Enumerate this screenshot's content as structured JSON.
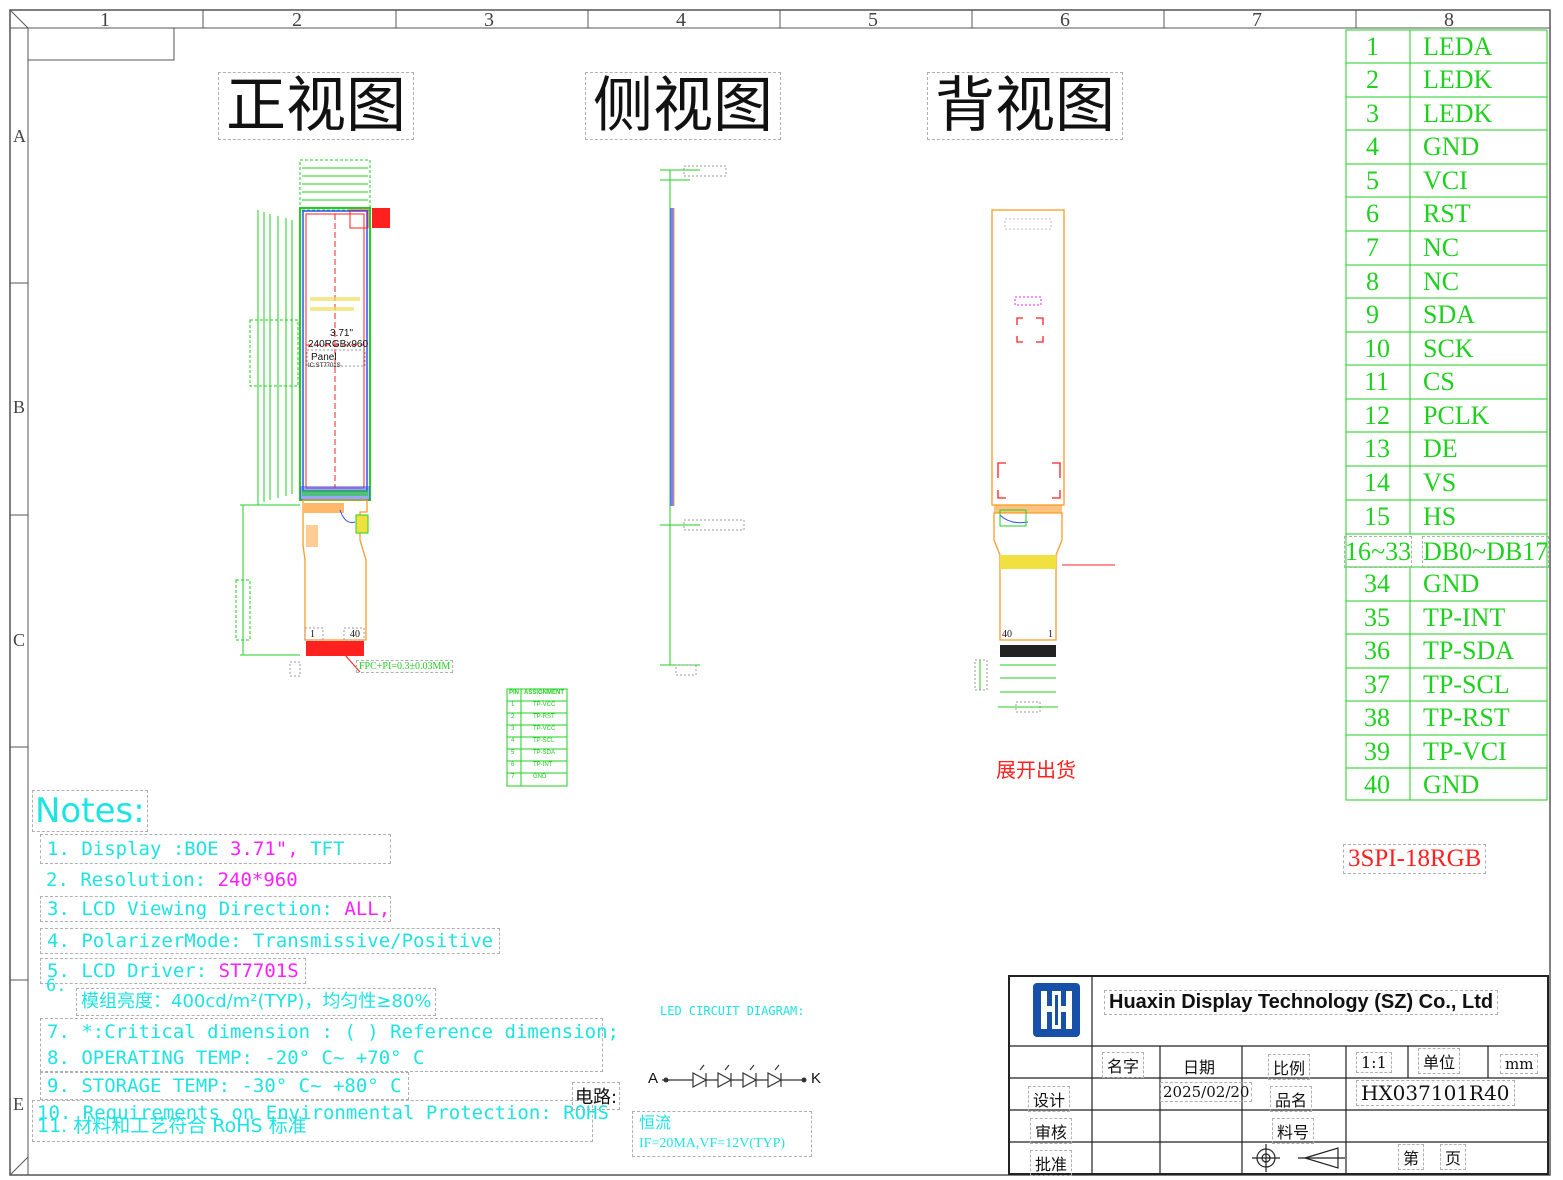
{
  "frame": {
    "columns": [
      "1",
      "2",
      "3",
      "4",
      "5",
      "6",
      "7",
      "8"
    ],
    "rows": [
      "A",
      "B",
      "C",
      "E"
    ]
  },
  "views": {
    "front": "正视图",
    "side": "侧视图",
    "back": "背视图"
  },
  "front_view": {
    "size": "3.71\"",
    "resolution": "240RGBx960",
    "panel": "Panel",
    "ic": "IC:ST7701S",
    "fpc_pin_left": "1",
    "fpc_pin_right": "40",
    "fpc_note": "FPC+PI=0.3±0.03MM"
  },
  "back_view": {
    "pin_left": "40",
    "pin_right": "1",
    "ship_note": "展开出货"
  },
  "tp_table": {
    "header": [
      "PIN",
      "ASSIGNMENT"
    ],
    "rows": [
      [
        "1",
        "TP-VCC"
      ],
      [
        "2",
        "TP-RST"
      ],
      [
        "3",
        "TP-VCC"
      ],
      [
        "4",
        "TP-SCL"
      ],
      [
        "5",
        "TP-SDA"
      ],
      [
        "6",
        "TP-INT"
      ],
      [
        "7",
        "GND"
      ]
    ]
  },
  "pins": [
    {
      "num": "1",
      "sig": "LEDA"
    },
    {
      "num": "2",
      "sig": "LEDK"
    },
    {
      "num": "3",
      "sig": "LEDK"
    },
    {
      "num": "4",
      "sig": "GND"
    },
    {
      "num": "5",
      "sig": "VCI"
    },
    {
      "num": "6",
      "sig": "RST"
    },
    {
      "num": "7",
      "sig": "NC"
    },
    {
      "num": "8",
      "sig": "NC"
    },
    {
      "num": "9",
      "sig": "SDA"
    },
    {
      "num": "10",
      "sig": "SCK"
    },
    {
      "num": "11",
      "sig": "CS"
    },
    {
      "num": "12",
      "sig": "PCLK"
    },
    {
      "num": "13",
      "sig": "DE"
    },
    {
      "num": "14",
      "sig": "VS"
    },
    {
      "num": "15",
      "sig": "HS"
    },
    {
      "num": "16~33",
      "sig": "DB0~DB17"
    },
    {
      "num": "34",
      "sig": "GND"
    },
    {
      "num": "35",
      "sig": "TP-INT"
    },
    {
      "num": "36",
      "sig": "TP-SDA"
    },
    {
      "num": "37",
      "sig": "TP-SCL"
    },
    {
      "num": "38",
      "sig": "TP-RST"
    },
    {
      "num": "39",
      "sig": "TP-VCI"
    },
    {
      "num": "40",
      "sig": "GND"
    }
  ],
  "interface": "3SPI-18RGB",
  "notes": {
    "title": "Notes:",
    "n1_label": "1. Display :BOE ",
    "n1_size": "3.71\",",
    "n1_type": "  TFT",
    "n2_label": "2. Resolution: ",
    "n2_value": "240*960",
    "n3_label": "3. LCD Viewing Direction: ",
    "n3_value": "ALL,",
    "n4": "4. PolarizerMode: Transmissive/Positive",
    "n5_label": "5. LCD Driver: ",
    "n5_value": "ST7701S",
    "n6_num": "6.",
    "n6": "模组亮度：400cd/m²(TYP)，均匀性≥80%",
    "n7": "7. *:Critical dimension : ( ) Reference dimension;",
    "n8": "8. OPERATING TEMP: -20° C~ +70° C",
    "n9": "9. STORAGE TEMP: -30° C~ +80° C",
    "n10": "10. Requirements on Environmental Protection: ROHS",
    "n11": "11. 材料和工艺符合 RoHS 标准"
  },
  "led": {
    "title": "LED CIRCUIT DIAGRAM:",
    "circuit_label": "电路:",
    "anode": "A",
    "cathode": "K",
    "mode": "恒流",
    "spec": "IF=20MA,VF=12V(TYP)"
  },
  "title_block": {
    "company": "Huaxin Display Technology (SZ) Co., Ltd",
    "name_col": "名字",
    "date_col": "日期",
    "scale_label": "比例",
    "scale_value": "1:1",
    "unit_label": "单位",
    "unit_value": "mm",
    "design": "设计",
    "date": "2025/02/20",
    "product_label": "品名",
    "product": "HX037101R40",
    "review": "审核",
    "part_label": "料号",
    "approve": "批准",
    "sheet": "第",
    "page": "页"
  },
  "colors": {
    "green": "#1fd01f",
    "cyan": "#1fe3e3",
    "magenta": "#ff1fff",
    "red": "#ff2020",
    "orange": "#ff9a2a",
    "logo_blue": "#1750a8"
  }
}
